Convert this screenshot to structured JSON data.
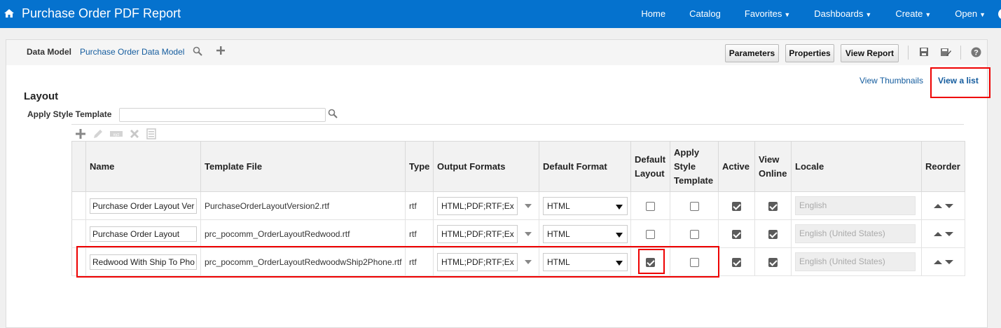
{
  "header": {
    "title": "Purchase Order PDF Report",
    "nav": [
      {
        "label": "Home",
        "caret": false
      },
      {
        "label": "Catalog",
        "caret": false
      },
      {
        "label": "Favorites",
        "caret": true
      },
      {
        "label": "Dashboards",
        "caret": true
      },
      {
        "label": "Create",
        "caret": true
      },
      {
        "label": "Open",
        "caret": true
      }
    ]
  },
  "toolbar": {
    "data_model_label": "Data Model",
    "data_model_link": "Purchase Order Data Model",
    "parameters": "Parameters",
    "properties": "Properties",
    "view_report": "View Report"
  },
  "view": {
    "thumbnails": "View Thumbnails",
    "list": "View a list"
  },
  "layout": {
    "heading": "Layout",
    "apply_style_label": "Apply Style Template",
    "apply_style_value": ""
  },
  "table": {
    "headers": {
      "name": "Name",
      "template_file": "Template File",
      "type": "Type",
      "output_formats": "Output Formats",
      "default_format": "Default Format",
      "default_layout": "Default Layout",
      "apply_style_template": "Apply Style Template",
      "active": "Active",
      "view_online": "View Online",
      "locale": "Locale",
      "reorder": "Reorder"
    },
    "rows": [
      {
        "name": "Purchase Order Layout Ver",
        "file": "PurchaseOrderLayoutVersion2.rtf",
        "type": "rtf",
        "formats": "HTML;PDF;RTF;Ex",
        "default_format": "HTML",
        "default_layout": false,
        "apply_style": false,
        "active": true,
        "view_online": true,
        "locale": "English"
      },
      {
        "name": "Purchase Order Layout",
        "file": "prc_pocomm_OrderLayoutRedwood.rtf",
        "type": "rtf",
        "formats": "HTML;PDF;RTF;Ex",
        "default_format": "HTML",
        "default_layout": false,
        "apply_style": false,
        "active": true,
        "view_online": true,
        "locale": "English (United States)"
      },
      {
        "name": "Redwood With Ship To Pho",
        "file": "prc_pocomm_OrderLayoutRedwoodwShip2Phone.rtf",
        "type": "rtf",
        "formats": "HTML;PDF;RTF;Ex",
        "default_format": "HTML",
        "default_layout": true,
        "apply_style": false,
        "active": true,
        "view_online": true,
        "locale": "English (United States)"
      }
    ]
  },
  "icons": [
    "home-icon",
    "search-icon",
    "plus-icon",
    "save-icon",
    "save-as-icon",
    "help-icon",
    "edit-icon",
    "rename-icon",
    "delete-icon",
    "properties-icon",
    "chevron-up-icon",
    "chevron-down-icon"
  ],
  "colors": {
    "banner": "#0572ce",
    "link": "#145c9e",
    "highlight": "#e00000"
  }
}
